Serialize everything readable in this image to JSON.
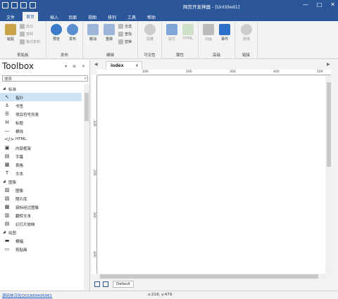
{
  "window": {
    "title": "网页开发神器 - [Untitled1]",
    "controls": [
      "—",
      "□",
      "✕"
    ]
  },
  "menu": {
    "tabs": [
      "文件",
      "首页",
      "插入",
      "页面",
      "视图",
      "排列",
      "工具",
      "帮助"
    ],
    "active": "首页"
  },
  "ribbon": {
    "groups": [
      {
        "label": "剪贴板",
        "big": "粘贴",
        "small": [
          "剪切",
          "复制",
          "格式复制"
        ]
      },
      {
        "label": "发布",
        "big": [
          "预览",
          "发布"
        ]
      },
      {
        "label": "编辑",
        "big": [
          "撤消",
          "重做"
        ],
        "small": [
          "全选",
          "查找",
          "替换"
        ]
      },
      {
        "label": "可见性",
        "big": [
          "隐藏"
        ]
      },
      {
        "label": "属性",
        "big": [
          "属性",
          "HTML"
        ]
      },
      {
        "label": "高级",
        "big": [
          "动画",
          "事件"
        ]
      },
      {
        "label": "链接",
        "big": [
          "链接"
        ]
      }
    ]
  },
  "toolbox": {
    "title": "Toolbox",
    "controls": "▾ ⊕ ✕",
    "search_placeholder": "搜索",
    "categories": [
      {
        "name": "标准",
        "items": [
          {
            "icon": "pointer-icon",
            "glyph": "↖",
            "label": "指针",
            "selected": true
          },
          {
            "icon": "anchor-icon",
            "glyph": "⚓",
            "label": "书签"
          },
          {
            "icon": "list-icon",
            "glyph": "☰",
            "label": "项目符号列表"
          },
          {
            "icon": "heading-icon",
            "glyph": "H",
            "label": "标题"
          },
          {
            "icon": "line-icon",
            "glyph": "—",
            "label": "横线"
          },
          {
            "icon": "code-icon",
            "glyph": "</>",
            "label": "HTML"
          },
          {
            "icon": "frame-icon",
            "glyph": "▣",
            "label": "内部框架"
          },
          {
            "icon": "caption-icon",
            "glyph": "▤",
            "label": "字幕"
          },
          {
            "icon": "table-icon",
            "glyph": "▦",
            "label": "表格"
          },
          {
            "icon": "text-icon",
            "glyph": "T",
            "label": "文本"
          }
        ]
      },
      {
        "name": "图像",
        "items": [
          {
            "icon": "image-icon",
            "glyph": "▨",
            "label": "图像"
          },
          {
            "icon": "gallery-icon",
            "glyph": "▧",
            "label": "照片库"
          },
          {
            "icon": "rollover-icon",
            "glyph": "▩",
            "label": "鼠标经过图像"
          },
          {
            "icon": "flip-icon",
            "glyph": "▥",
            "label": "翻转文本"
          },
          {
            "icon": "slideshow-icon",
            "glyph": "▤",
            "label": "幻灯片放映"
          }
        ]
      },
      {
        "name": "绘图",
        "items": [
          {
            "icon": "rectangle-icon",
            "glyph": "▬",
            "label": "横幅"
          },
          {
            "icon": "clip-icon",
            "glyph": "▭",
            "label": "剪贴画"
          }
        ]
      }
    ]
  },
  "document": {
    "tab": "index",
    "ruler_h": [
      "100",
      "200",
      "300",
      "400",
      "500"
    ],
    "ruler_v": [
      "100",
      "200",
      "300",
      "400"
    ],
    "bottom_tab": "Default"
  },
  "status": {
    "link": "源码侠汉化QQ1669495961",
    "coords": "x:218, y:479"
  },
  "colors": {
    "accent": "#2b579a",
    "selection": "#cde3f6"
  }
}
